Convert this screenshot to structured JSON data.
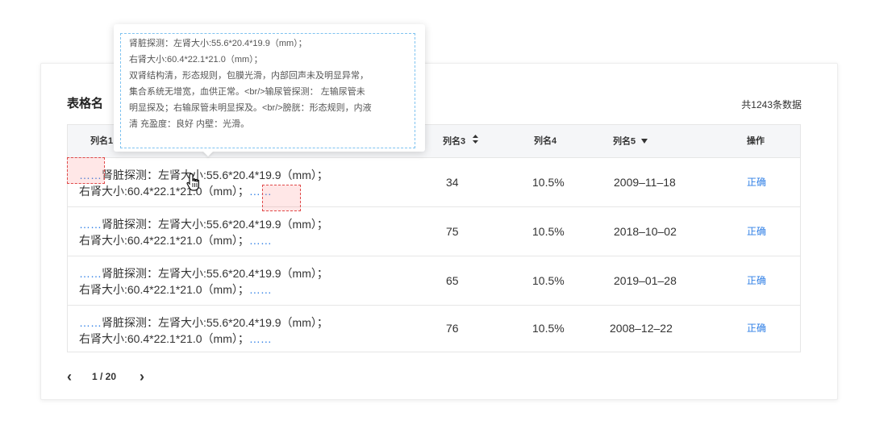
{
  "table": {
    "title": "表格名",
    "total": "共1243条数据",
    "columns": [
      "列名1",
      "列名3",
      "列名4",
      "列名5",
      "操作"
    ],
    "rows": [
      {
        "line1": "肾脏探测：左肾大小:55.6*20.4*19.9（mm）；",
        "line2": "右肾大小:60.4*22.1*21.0（mm）；",
        "col3": "34",
        "col4": "10.5%",
        "col5": "2009–11–18",
        "action": "正确"
      },
      {
        "line1": "肾脏探测：左肾大小:55.6*20.4*19.9（mm）；",
        "line2": "右肾大小:60.4*22.1*21.0（mm）；",
        "col3": "75",
        "col4": "10.5%",
        "col5": "2018–10–02",
        "action": "正确"
      },
      {
        "line1": "肾脏探测：左肾大小:55.6*20.4*19.9（mm）；",
        "line2": "右肾大小:60.4*22.1*21.0（mm）；",
        "col3": "65",
        "col4": "10.5%",
        "col5": "2019–01–28",
        "action": "正确"
      },
      {
        "line1": "肾脏探测：左肾大小:55.6*20.4*19.9（mm）；",
        "line2": "右肾大小:60.4*22.1*21.0（mm）；",
        "col3": "76",
        "col4": "10.5%",
        "col5": "2008–12–22",
        "action": "正确"
      }
    ],
    "ellipsis": "……"
  },
  "pagination": {
    "page": "1 / 20",
    "prev": "‹",
    "next": "›"
  },
  "tooltip": {
    "lines": [
      "肾脏探测：左肾大小:55.6*20.4*19.9（mm）；",
      "右肾大小:60.4*22.1*21.0（mm）；",
      "双肾结构清，形态规则，包膜光滑，内部回声未及明显异常，",
      "集合系统无增宽，血供正常。<br/>输尿管探测：  左输尿管未",
      "明显探及；右输尿管未明显探及。<br/>膀胱：形态规则，内液",
      "清  充盈度：良好  内壁：光滑。"
    ]
  },
  "icons": {
    "sort": "sort-both-icon",
    "filter": "caret-down-icon",
    "cursor": "hand-pointer-icon"
  },
  "colors": {
    "link": "#2f7fe6",
    "header_bg": "#f5f6f8",
    "marker": "#e04a4a"
  }
}
